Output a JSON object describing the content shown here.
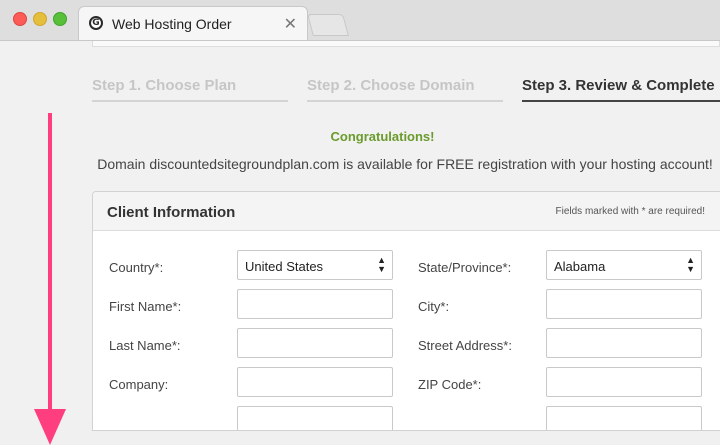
{
  "browser": {
    "tab_title": "Web Hosting Order",
    "favicon_glyph": "G",
    "close_glyph": "✕"
  },
  "steps": [
    {
      "label": "Step 1. Choose Plan",
      "active": false
    },
    {
      "label": "Step 2. Choose Domain",
      "active": false
    },
    {
      "label": "Step 3. Review & Complete",
      "active": true
    }
  ],
  "notice": {
    "congrats": "Congratulations!",
    "domain_message": "Domain discountedsitegroundplan.com is available for FREE registration with your hosting account!"
  },
  "client_info": {
    "title": "Client Information",
    "required_note": "Fields marked with * are required!",
    "fields": {
      "country": {
        "label": "Country*:",
        "value": "United States"
      },
      "state": {
        "label": "State/Province*:",
        "value": "Alabama"
      },
      "first_name": {
        "label": "First Name*:",
        "value": ""
      },
      "city": {
        "label": "City*:",
        "value": ""
      },
      "last_name": {
        "label": "Last Name*:",
        "value": ""
      },
      "street": {
        "label": "Street Address*:",
        "value": ""
      },
      "company": {
        "label": "Company:",
        "value": ""
      },
      "zip": {
        "label": "ZIP Code*:",
        "value": ""
      }
    }
  },
  "colors": {
    "accent_green": "#6a9b2c",
    "arrow_pink": "#ff3e7f"
  }
}
